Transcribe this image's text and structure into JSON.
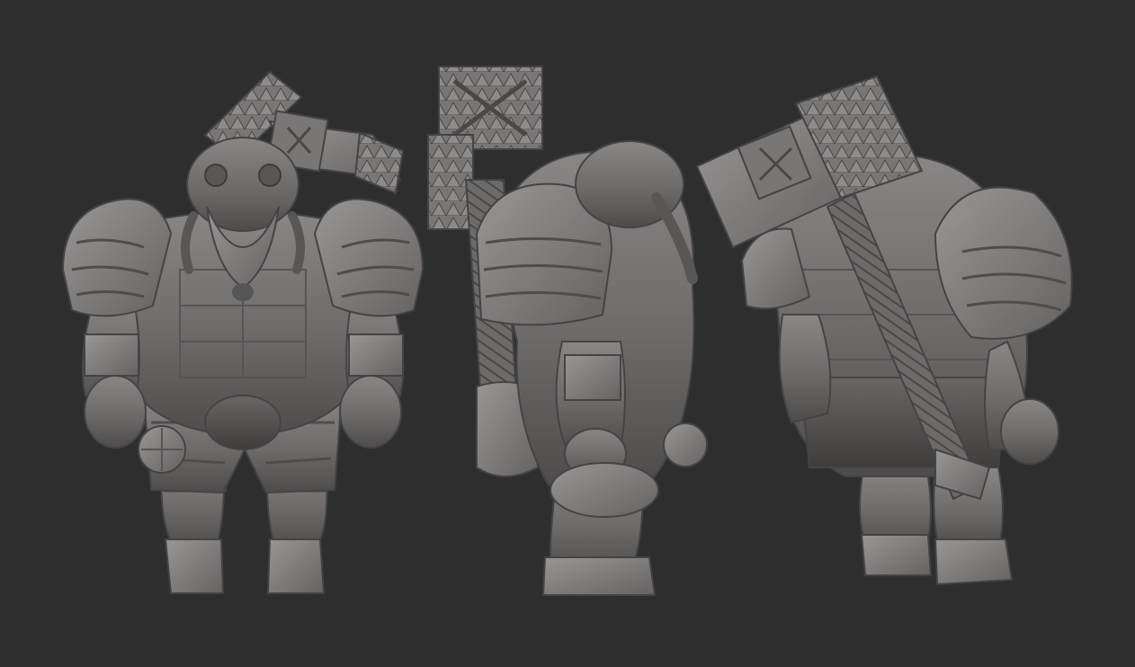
{
  "scene": {
    "background_color": "#2e2e2e",
    "material_color": "#6f6b6b",
    "views": [
      {
        "name": "front-view"
      },
      {
        "name": "side-view"
      },
      {
        "name": "back-three-quarter-view"
      }
    ]
  }
}
